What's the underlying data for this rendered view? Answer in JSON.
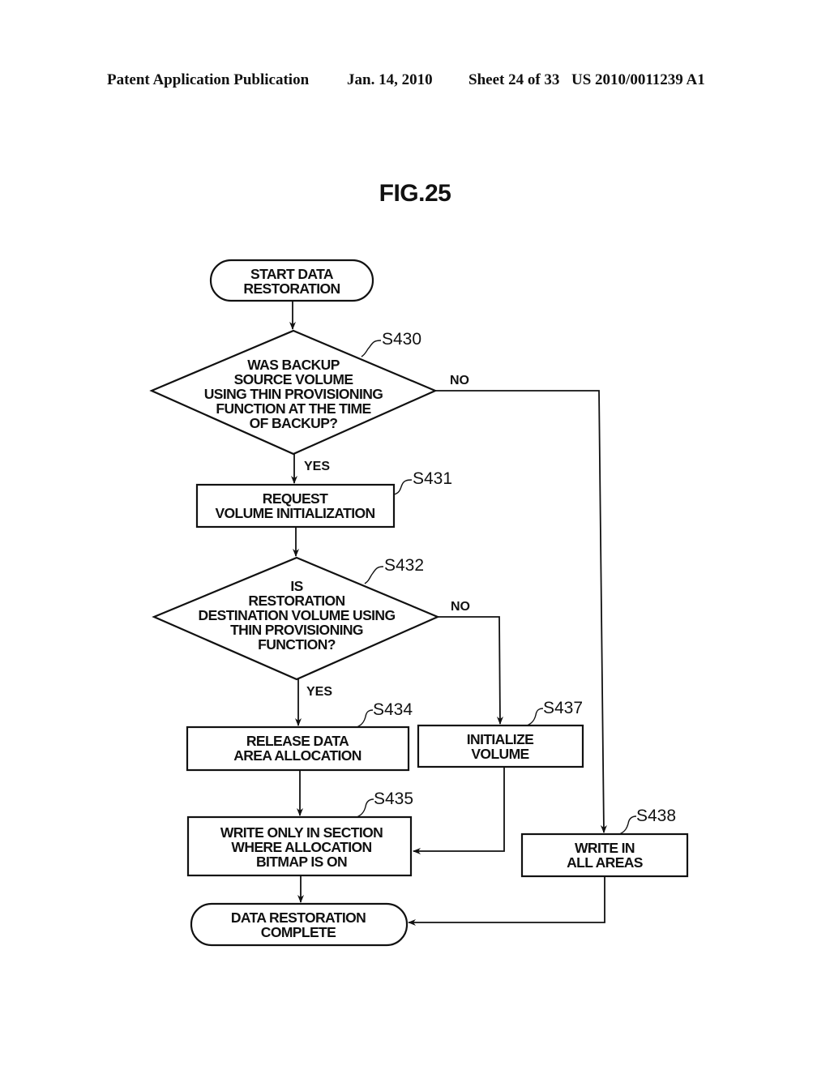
{
  "header": {
    "publication": "Patent Application Publication",
    "date": "Jan. 14, 2010",
    "sheet": "Sheet 24 of 33",
    "number": "US 2010/0011239 A1"
  },
  "figure": {
    "title": "FIG.25"
  },
  "flowchart": {
    "start": {
      "lines": [
        "START DATA",
        "RESTORATION"
      ]
    },
    "s430": {
      "ref": "S430",
      "lines": [
        "WAS BACKUP",
        "SOURCE VOLUME",
        "USING THIN PROVISIONING",
        "FUNCTION AT THE TIME",
        "OF BACKUP?"
      ],
      "yes": "YES",
      "no": "NO"
    },
    "s431": {
      "ref": "S431",
      "lines": [
        "REQUEST",
        "VOLUME INITIALIZATION"
      ]
    },
    "s432": {
      "ref": "S432",
      "lines": [
        "IS",
        "RESTORATION",
        "DESTINATION VOLUME USING",
        "THIN PROVISIONING",
        "FUNCTION?"
      ],
      "yes": "YES",
      "no": "NO"
    },
    "s434": {
      "ref": "S434",
      "lines": [
        "RELEASE DATA",
        "AREA ALLOCATION"
      ]
    },
    "s437": {
      "ref": "S437",
      "lines": [
        "INITIALIZE",
        "VOLUME"
      ]
    },
    "s435": {
      "ref": "S435",
      "lines": [
        "WRITE ONLY IN SECTION",
        "WHERE ALLOCATION",
        "BITMAP IS ON"
      ]
    },
    "s438": {
      "ref": "S438",
      "lines": [
        "WRITE IN",
        "ALL AREAS"
      ]
    },
    "end": {
      "lines": [
        "DATA RESTORATION",
        "COMPLETE"
      ]
    }
  }
}
